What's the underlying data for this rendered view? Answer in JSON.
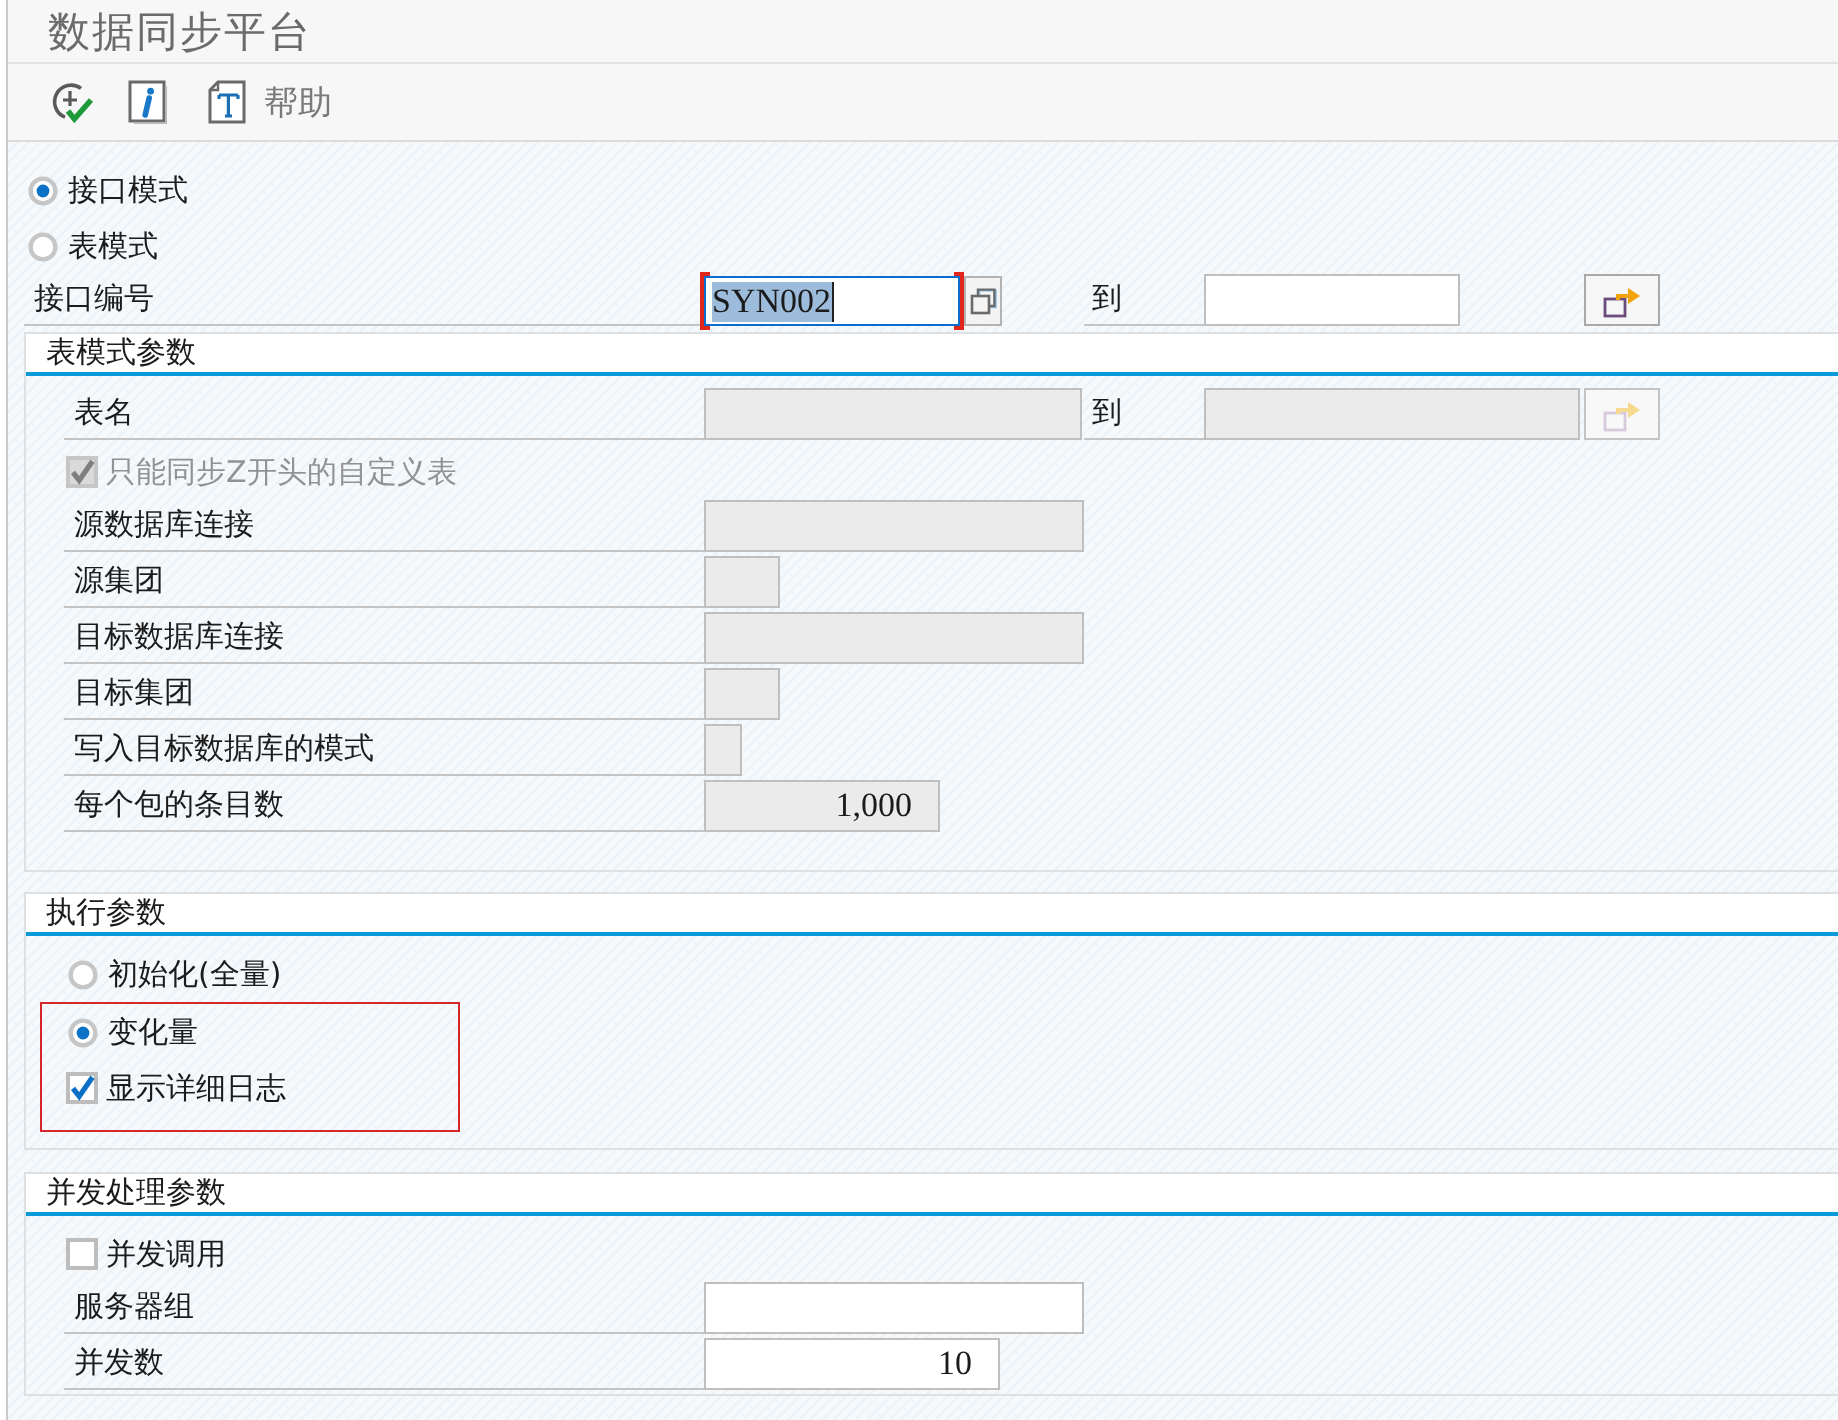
{
  "window": {
    "title": "数据同步平台"
  },
  "toolbar": {
    "help_label": "帮助"
  },
  "modes": [
    {
      "label": "接口模式",
      "selected": true
    },
    {
      "label": "表模式",
      "selected": false
    }
  ],
  "interface_number": {
    "label": "接口编号",
    "value": "SYN002",
    "focused": true,
    "to_label": "到"
  },
  "table_params": {
    "title": "表模式参数",
    "rows": [
      {
        "kind": "range",
        "label": "表名",
        "to_label": "到",
        "disabled": true
      },
      {
        "kind": "checkbox",
        "label": "只能同步Z开头的自定义表",
        "checked": true,
        "disabled": true
      },
      {
        "kind": "field",
        "label": "源数据库连接",
        "disabled": true
      },
      {
        "kind": "field",
        "label": "源集团",
        "disabled": true
      },
      {
        "kind": "field",
        "label": "目标数据库连接",
        "disabled": true
      },
      {
        "kind": "field",
        "label": "目标集团",
        "disabled": true
      },
      {
        "kind": "field",
        "label": "写入目标数据库的模式",
        "disabled": true
      },
      {
        "kind": "number",
        "label": "每个包的条目数",
        "value": "1,000",
        "disabled": true
      }
    ]
  },
  "execution": {
    "title": "执行参数",
    "rows": [
      {
        "kind": "radio",
        "label": "初始化(全量)",
        "selected": false,
        "marked": false
      },
      {
        "kind": "radio",
        "label": "变化量",
        "selected": true,
        "marked": true
      },
      {
        "kind": "checkbox",
        "label": "显示详细日志",
        "checked": true,
        "marked": true
      }
    ]
  },
  "parallel": {
    "title": "并发处理参数",
    "rows": [
      {
        "kind": "checkbox",
        "label": "并发调用",
        "checked": false,
        "disabled": false
      },
      {
        "kind": "field",
        "label": "服务器组",
        "disabled": false
      },
      {
        "kind": "number",
        "label": "并发数",
        "value": "10",
        "disabled": false
      }
    ]
  }
}
